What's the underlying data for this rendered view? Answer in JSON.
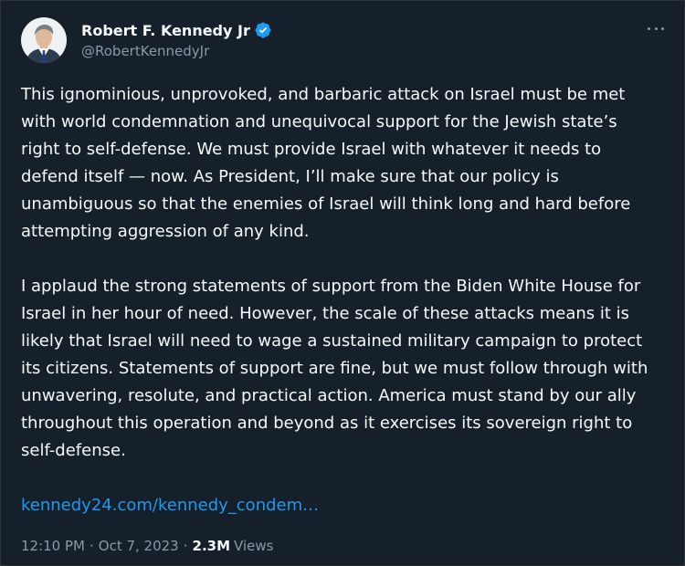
{
  "author": {
    "display_name": "Robert F. Kennedy Jr",
    "handle": "@RobertKennedyJr",
    "verified": true
  },
  "tweet": {
    "paragraph_1": "This ignominious, unprovoked, and barbaric attack on Israel must be met\nwith world condemnation and unequivocal support for the Jewish state’s\nright to self-defense. We must provide Israel with whatever it needs to\ndefend itself — now. As President, I’ll make sure that our policy is\nunambiguous so that the enemies of Israel will think long and hard before\nattempting aggression of any kind.",
    "paragraph_2": "I applaud the strong statements of support from the Biden White House for\nIsrael in her hour of need. However, the scale of these attacks means it is\nlikely that Israel will need to wage a sustained military campaign to protect\nits citizens. Statements of support are fine, but we must follow through with\nunwavering, resolute, and practical action. America must stand by our ally\nthroughout this operation and beyond as it exercises its sovereign right to\nself-defense.",
    "link_text": "kennedy24.com/kennedy_condem…"
  },
  "meta": {
    "time": "12:10 PM",
    "separator": "·",
    "date": "Oct 7, 2023",
    "views_count": "2.3M",
    "views_label": "Views"
  },
  "colors": {
    "background": "#15202b",
    "text": "#f7f9f9",
    "muted": "#8b98a5",
    "link": "#1d9bf0",
    "verified": "#1d9bf0"
  },
  "icons": {
    "verified": "verified-badge-icon",
    "more": "more-options-icon"
  }
}
